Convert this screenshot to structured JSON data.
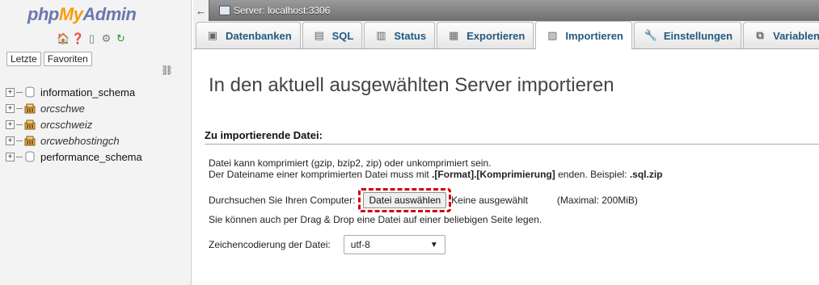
{
  "sidebar": {
    "logo": {
      "php": "php",
      "my": "My",
      "admin": "Admin"
    },
    "quick_icons": [
      "home-icon",
      "help-icon",
      "docs-icon",
      "settings-icon",
      "reload-icon"
    ],
    "buttons": {
      "recent": "Letzte",
      "favorites": "Favoriten"
    },
    "databases": [
      {
        "name": "information_schema",
        "italic": false
      },
      {
        "name": "orcschwe",
        "italic": true
      },
      {
        "name": "orcschweiz",
        "italic": true
      },
      {
        "name": "orcwebhostingch",
        "italic": true
      },
      {
        "name": "performance_schema",
        "italic": false
      }
    ]
  },
  "topbar": {
    "back": "←",
    "server": "Server: localhost:3306"
  },
  "tabs": [
    {
      "label": "Datenbanken",
      "icon": "database-icon",
      "active": false
    },
    {
      "label": "SQL",
      "icon": "sql-icon",
      "active": false
    },
    {
      "label": "Status",
      "icon": "status-icon",
      "active": false
    },
    {
      "label": "Exportieren",
      "icon": "export-icon",
      "active": false
    },
    {
      "label": "Importieren",
      "icon": "import-icon",
      "active": true
    },
    {
      "label": "Einstellungen",
      "icon": "wrench-icon",
      "active": false
    },
    {
      "label": "Variablen",
      "icon": "variables-icon",
      "active": false
    }
  ],
  "main": {
    "title": "In den aktuell ausgewählten Server importieren",
    "section": "Zu importierende Datei:",
    "line1": "Datei kann komprimiert (gzip, bzip2, zip) oder unkomprimiert sein.",
    "line2_a": "Der Dateiname einer komprimierten Datei muss mit ",
    "line2_b": ".[Format].[Komprimierung]",
    "line2_c": " enden. Beispiel: ",
    "line2_d": ".sql.zip",
    "browse_label": "Durchsuchen Sie Ihren Computer:",
    "file_button": "Datei auswählen",
    "no_file": "Keine ausgewählt",
    "max_size": "(Maximal: 200MiB)",
    "drag_note": "Sie können auch per Drag & Drop eine Datei auf einer beliebigen Seite legen.",
    "charset_label": "Zeichencodierung der Datei:",
    "charset_value": "utf-8"
  },
  "colors": {
    "highlight": "#d0000f",
    "tab_text": "#235a81",
    "logo_orange": "#f89c0e",
    "logo_blue": "#6c78af"
  }
}
